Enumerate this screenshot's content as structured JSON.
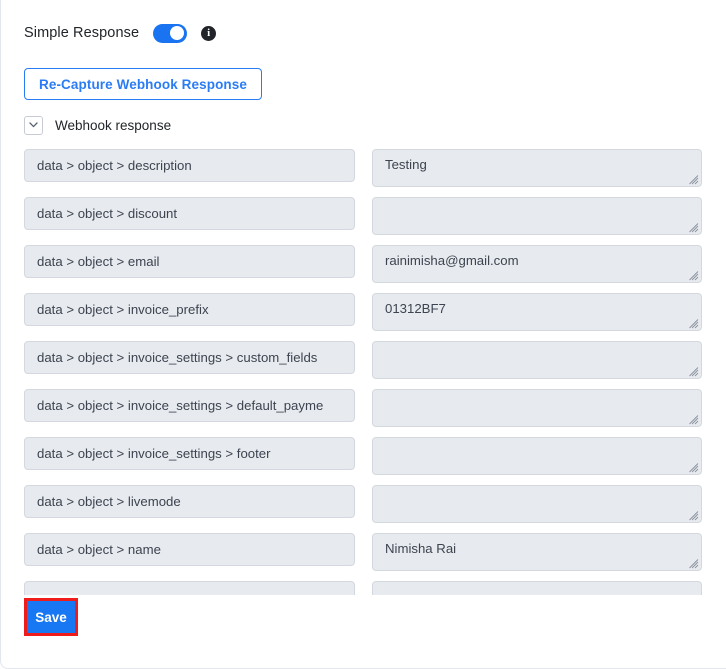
{
  "simple_response": {
    "label": "Simple Response",
    "toggle_state": "on",
    "info_icon_glyph": "i",
    "accent_color": "#1a73f0"
  },
  "recapture": {
    "label": "Re-Capture Webhook Response",
    "color": "#2a7cf5"
  },
  "collapse": {
    "label": "Webhook response",
    "icon": "chevron-down-icon",
    "expanded": true
  },
  "fields": [
    {
      "key": "data > object > description",
      "value": "Testing"
    },
    {
      "key": "data > object > discount",
      "value": ""
    },
    {
      "key": "data > object > email",
      "value": "rainimisha@gmail.com"
    },
    {
      "key": "data > object > invoice_prefix",
      "value": "01312BF7"
    },
    {
      "key": "data > object > invoice_settings > custom_fields",
      "value": ""
    },
    {
      "key": "data > object > invoice_settings > default_payme",
      "value": ""
    },
    {
      "key": "data > object > invoice_settings > footer",
      "value": ""
    },
    {
      "key": "data > object > livemode",
      "value": ""
    },
    {
      "key": "data > object > name",
      "value": "Nimisha Rai"
    },
    {
      "key": "",
      "value": ""
    }
  ],
  "field_placeholder": "",
  "save": {
    "label": "Save",
    "button_color": "#1877f2",
    "highlight_color": "#ef1c1c"
  }
}
